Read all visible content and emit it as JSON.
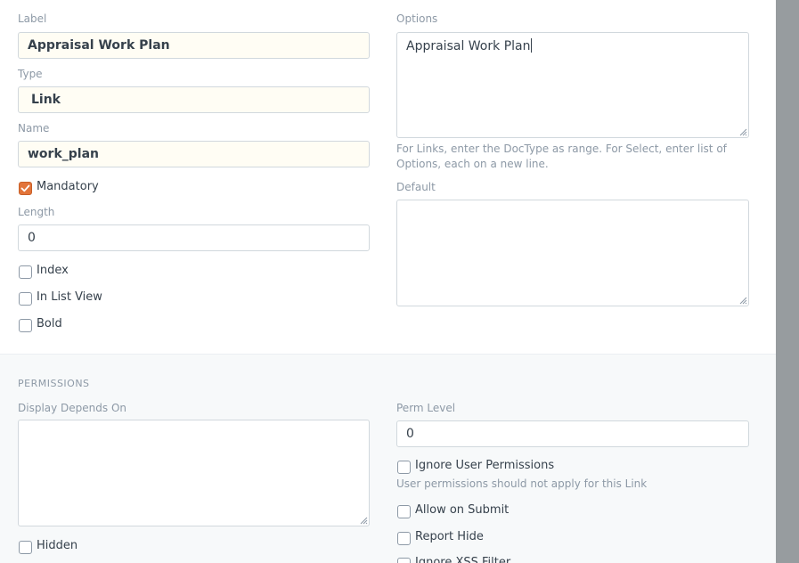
{
  "fields": {
    "label": {
      "caption": "Label",
      "value": "Appraisal Work Plan"
    },
    "type": {
      "caption": "Type",
      "value": "Link"
    },
    "name": {
      "caption": "Name",
      "value": "work_plan"
    },
    "mandatory": {
      "caption": "Mandatory",
      "checked": true
    },
    "length": {
      "caption": "Length",
      "value": "0"
    },
    "index": {
      "caption": "Index",
      "checked": false
    },
    "in_list_view": {
      "caption": "In List View",
      "checked": false
    },
    "bold": {
      "caption": "Bold",
      "checked": false
    },
    "options": {
      "caption": "Options",
      "value": "Appraisal Work Plan",
      "help": "For Links, enter the DocType as range. For Select, enter list of Options, each on a new line."
    },
    "default": {
      "caption": "Default",
      "value": ""
    }
  },
  "permissions": {
    "heading": "PERMISSIONS",
    "display_depends_on": {
      "caption": "Display Depends On",
      "value": ""
    },
    "hidden": {
      "caption": "Hidden",
      "checked": false
    },
    "perm_level": {
      "caption": "Perm Level",
      "value": "0"
    },
    "ignore_user_permissions": {
      "caption": "Ignore User Permissions",
      "checked": false,
      "help": "User permissions should not apply for this Link"
    },
    "allow_on_submit": {
      "caption": "Allow on Submit",
      "checked": false
    },
    "report_hide": {
      "caption": "Report Hide",
      "checked": false
    },
    "ignore_xss_filter": {
      "caption": "Ignore XSS Filter",
      "checked": false
    }
  },
  "colors": {
    "checkbox_checked": "#e2743a",
    "filled_input_bg": "#fffdf4",
    "scrollbar": "#979c9f"
  }
}
